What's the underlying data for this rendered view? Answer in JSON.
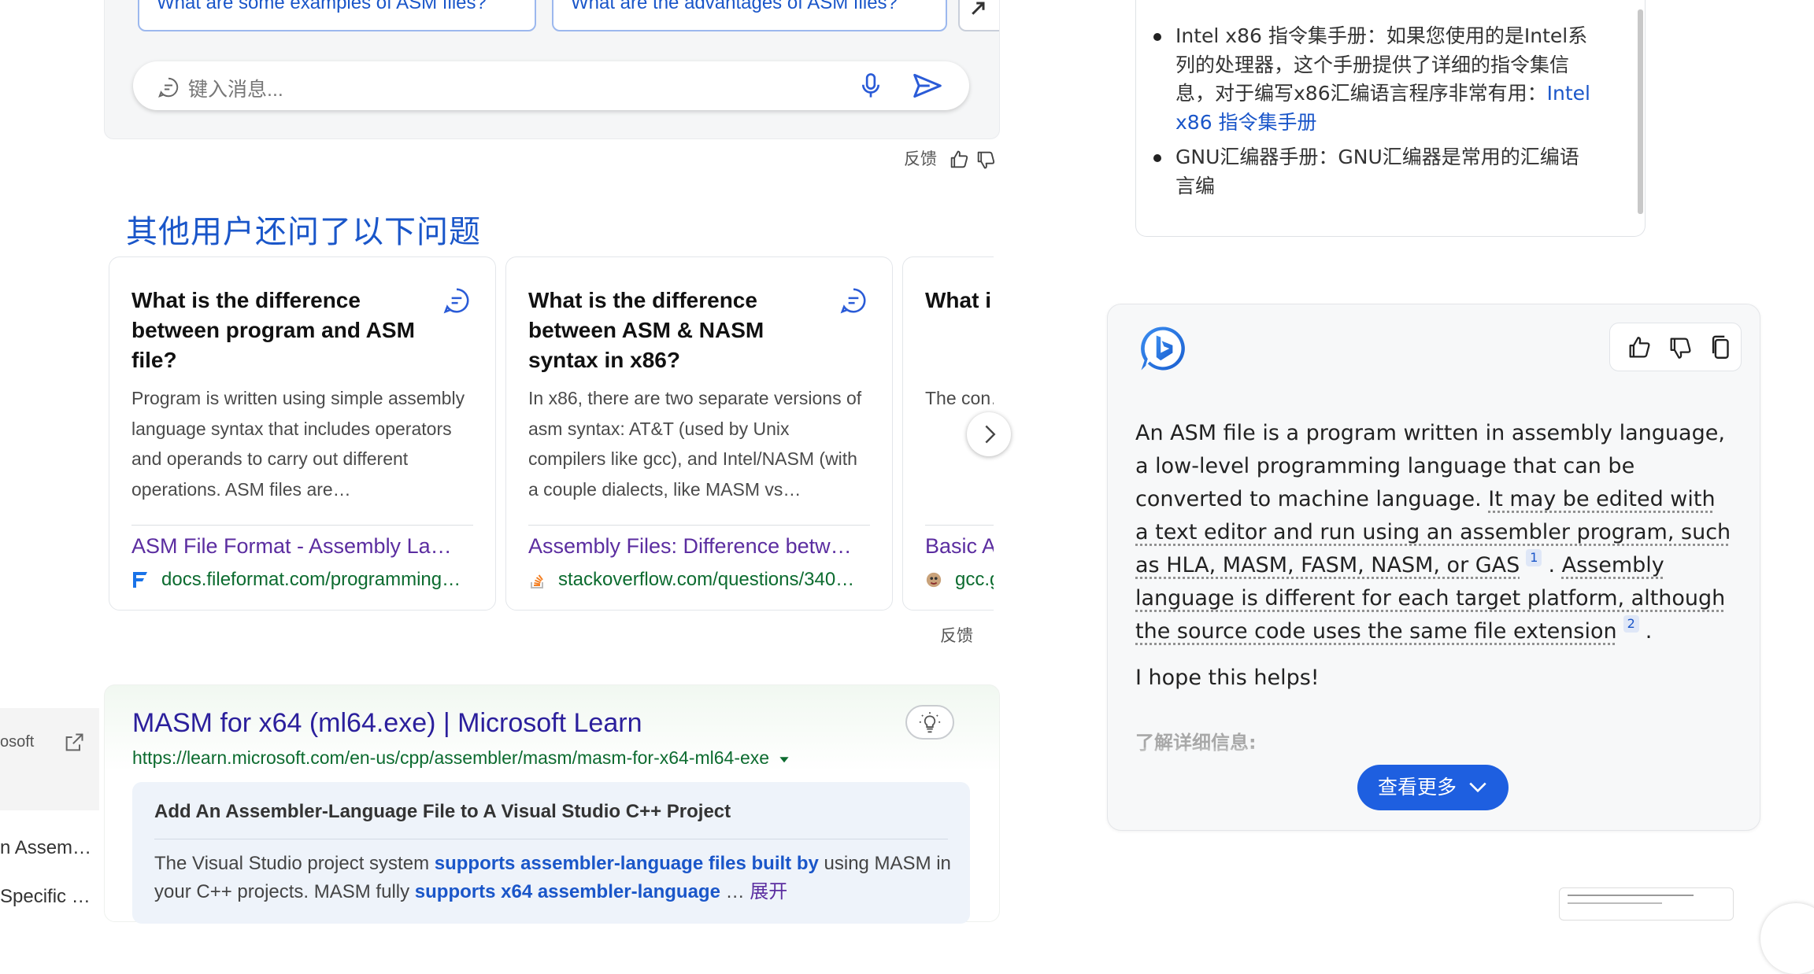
{
  "chat": {
    "suggestions": [
      "What are some examples of ASM files?",
      "What are the advantages of ASM files?"
    ],
    "input_placeholder": "键入消息...",
    "feedback_label": "反馈"
  },
  "paa": {
    "title": "其他用户还问了以下问题",
    "feedback_label": "反馈",
    "cards": [
      {
        "question": "What is the difference between program and ASM file?",
        "answer": "Program is written using simple assembly language syntax that includes operators and operands to carry out different operations. ASM files are…",
        "link_title": "ASM File Format - Assembly La…",
        "link_url": "docs.fileformat.com/programming…"
      },
      {
        "question": "What is the difference between ASM & NASM syntax in x86?",
        "answer": "In x86, there are two separate versions of asm syntax: AT&T (used by Unix compilers like gcc), and Intel/NASM (with a couple dialects, like MASM vs…",
        "link_title": "Assembly Files: Difference betw…",
        "link_url": "stackoverflow.com/questions/340…"
      },
      {
        "question": "What i… betwe… and ex…",
        "answer": "The con… instru… the asse… without…",
        "link_title": "Basic A…",
        "link_url": "gcc.g…"
      }
    ]
  },
  "result": {
    "title": "MASM for x64 (ml64.exe) | Microsoft Learn",
    "url": "https://learn.microsoft.com/en-us/cpp/assembler/masm/masm-for-x64-ml64-exe",
    "snippet_heading": "Add An Assembler-Language File to A Visual Studio C++ Project",
    "snippet_parts": [
      "The Visual Studio project system ",
      "supports assembler-language files built by",
      " using MASM in your C++ projects. MASM fully ",
      "supports x64 assembler-language",
      " … "
    ],
    "expand_label": "展开"
  },
  "left_panel": {
    "items": [
      "osoft",
      "n Assem…",
      "Specific …"
    ]
  },
  "references": {
    "items": [
      {
        "text": "Intel x86 指令集手册：如果您使用的是Intel系列的处理器，这个手册提供了详细的指令集信息，对于编写x86汇编语言程序非常有用：",
        "link": "Intel x86 指令集手册"
      },
      {
        "text": "GNU汇编器手册：GNU汇编器是常用的汇编语言编",
        "link": ""
      }
    ]
  },
  "bing": {
    "answer_intro": "An ASM file is a program written in assembly language, a low-level programming language that can be converted to machine language. ",
    "answer_claim1": "It may be edited with a text editor and run using an assembler program, such as HLA, MASM, FASM, NASM, or GAS",
    "cite1": "1",
    "answer_claim2": "Assembly language is different for each target platform, although the source code uses the same file extension",
    "cite2": "2",
    "closing": "I hope this helps!",
    "learn_more": "了解详细信息:",
    "see_more": "查看更多"
  },
  "colors": {
    "accent": "#1a56c9",
    "visited_link": "#5b2da0",
    "url_green": "#0c6b2f",
    "button_blue": "#1e5fe0"
  }
}
